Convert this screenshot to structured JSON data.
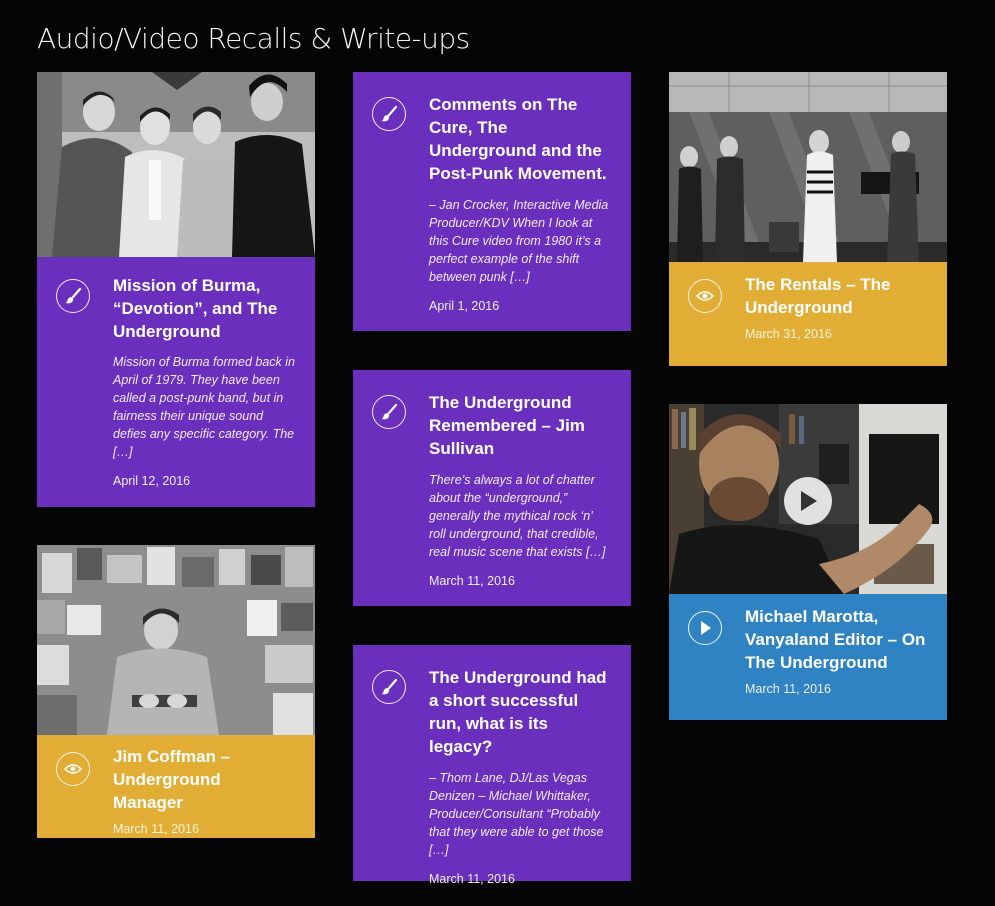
{
  "page": {
    "title": "Audio/Video Recalls & Write-ups"
  },
  "posts": [
    {
      "title": "Mission of Burma, “Devotion”, and The Underground",
      "excerpt": "Mission of Burma formed back in April of 1979. They have been called a post-punk band, but in fairness their unique sound defies any specific category. The […]",
      "date": "April 12, 2016",
      "icon": "brush-icon",
      "color": "#6b2fbd"
    },
    {
      "title": "Jim Coffman – Underground Manager",
      "date": "March 11, 2016",
      "icon": "eye-icon",
      "color": "#e2ad34"
    },
    {
      "title": "Comments on The Cure, The Underground and the Post-Punk Movement.",
      "excerpt": "– Jan Crocker, Interactive Media Producer/KDV When I look at this Cure video from 1980 it’s a perfect example of the shift between punk […]",
      "date": "April 1, 2016",
      "icon": "brush-icon",
      "color": "#6b2fbd"
    },
    {
      "title": "The Underground Remembered – Jim Sullivan",
      "excerpt": "There’s always a lot of chatter about the “underground,” generally the mythical rock ‘n’ roll underground, that credible, real music scene that exists […]",
      "date": "March 11, 2016",
      "icon": "brush-icon",
      "color": "#6b2fbd"
    },
    {
      "title": "The Underground had a short successful run, what is its legacy?",
      "excerpt": "– Thom Lane, DJ/Las Vegas Denizen – Michael Whittaker, Producer/Consultant “Probably that they were able to get those […]",
      "date": "March 11, 2016",
      "icon": "brush-icon",
      "color": "#6b2fbd"
    },
    {
      "title": "The Rentals – The Underground",
      "date": "March 31, 2016",
      "icon": "eye-icon",
      "color": "#e2ad34"
    },
    {
      "title": "Michael Marotta, Vanyaland Editor – On The Underground",
      "date": "March 11, 2016",
      "icon": "play-icon",
      "color": "#2f83c3"
    }
  ]
}
